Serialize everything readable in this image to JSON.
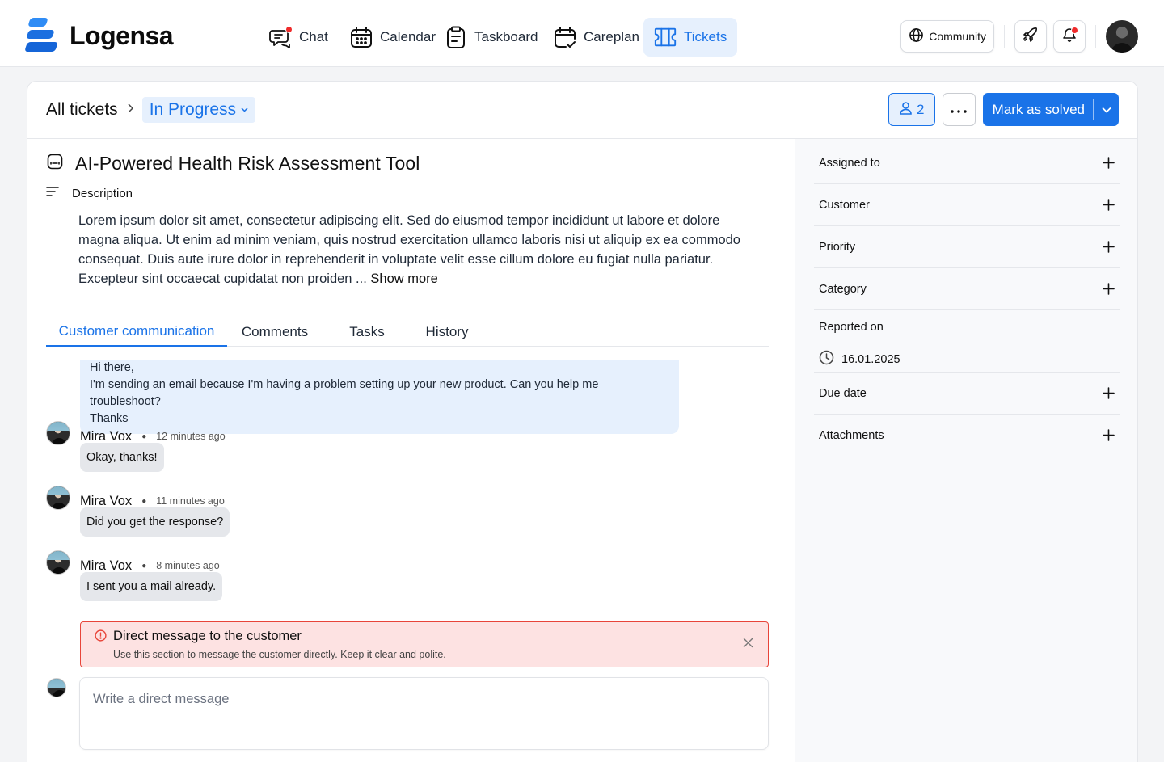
{
  "brand": {
    "name": "Logensa"
  },
  "nav": {
    "items": [
      {
        "label": "Chat",
        "icon": "chat-icon",
        "active": false,
        "badge": true
      },
      {
        "label": "Calendar",
        "icon": "calendar-icon",
        "active": false
      },
      {
        "label": "Taskboard",
        "icon": "clipboard-icon",
        "active": false
      },
      {
        "label": "Careplan",
        "icon": "calendar-check-icon",
        "active": false
      },
      {
        "label": "Tickets",
        "icon": "ticket-icon",
        "active": true
      }
    ]
  },
  "topright": {
    "community_label": "Community",
    "community_icon": "globe-icon",
    "rocket_icon": "rocket-icon",
    "bell_icon": "bell-icon",
    "notification_dot": true
  },
  "header": {
    "breadcrumb_root": "All tickets",
    "status": "In Progress",
    "watchers_count": "2",
    "solve_label": "Mark as solved"
  },
  "ticket": {
    "title": "AI-Powered Health Risk Assessment Tool",
    "description_label": "Description",
    "description": "Lorem ipsum dolor sit amet, consectetur adipiscing elit. Sed do eiusmod tempor incididunt ut labore et dolore magna aliqua. Ut enim ad minim veniam, quis nostrud exercitation ullamco laboris nisi ut aliquip ex ea commodo consequat. Duis aute irure dolor in reprehenderit in voluptate velit esse cillum dolore eu fugiat nulla pariatur. Excepteur sint occaecat cupidatat non proiden ...",
    "show_more": "Show more"
  },
  "tabs": [
    {
      "label": "Customer communication",
      "active": true
    },
    {
      "label": "Comments",
      "active": false
    },
    {
      "label": "Tasks",
      "active": false
    },
    {
      "label": "History",
      "active": false
    }
  ],
  "incoming_message": {
    "lines": [
      "Hi there,",
      "I'm sending an email because I'm having a problem setting up your new product. Can you help me troubleshoot?",
      "Thanks"
    ]
  },
  "messages": [
    {
      "author": "Mira Vox",
      "time": "12 minutes ago",
      "text": "Okay, thanks!"
    },
    {
      "author": "Mira Vox",
      "time": "11 minutes ago",
      "text": "Did you get the response?"
    },
    {
      "author": "Mira Vox",
      "time": "8 minutes ago",
      "text": "I sent you a mail already."
    }
  ],
  "alert": {
    "title": "Direct message to the customer",
    "subtitle": "Use this section to message the customer directly. Keep it clear and polite."
  },
  "composer": {
    "placeholder": "Write a direct message"
  },
  "sidebar": {
    "fields": [
      {
        "label": "Assigned to"
      },
      {
        "label": "Customer"
      },
      {
        "label": "Priority"
      },
      {
        "label": "Category"
      }
    ],
    "reported": {
      "label": "Reported on",
      "value": "16.01.2025"
    },
    "fields_after": [
      {
        "label": "Due date"
      },
      {
        "label": "Attachments"
      }
    ]
  },
  "colors": {
    "accent": "#1a73e8",
    "accent_light": "#e6f0fd",
    "alert_bg": "#fde2e2",
    "alert_border": "#e8453a",
    "notification": "#ef2b2b"
  }
}
